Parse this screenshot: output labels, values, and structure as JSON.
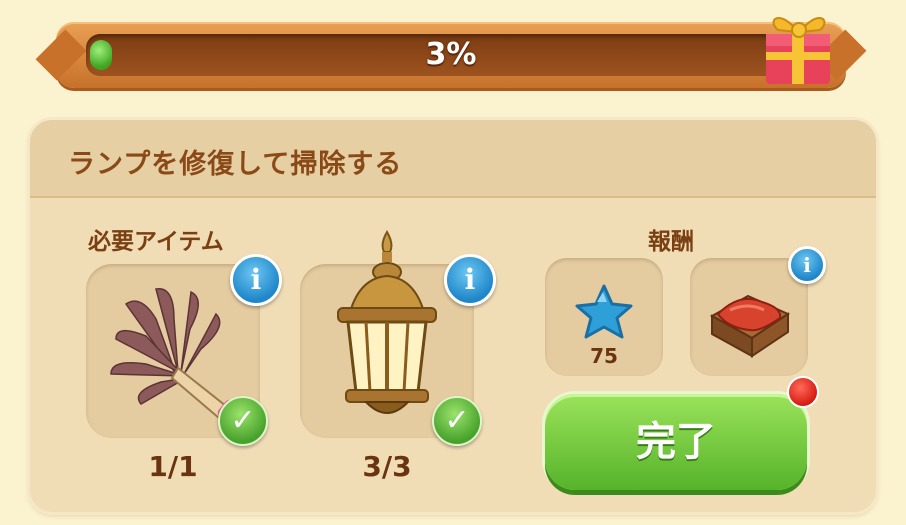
{
  "progress": {
    "percent_text": "3%",
    "value": 0.03
  },
  "quest": {
    "title": "ランプを修復して掃除する",
    "required_label": "必要アイテム",
    "reward_label": "報酬",
    "items": [
      {
        "name": "feather-duster",
        "count": "1/1",
        "complete": true
      },
      {
        "name": "lantern",
        "count": "3/3",
        "complete": true
      }
    ],
    "rewards": [
      {
        "name": "blue-star",
        "count": "75"
      },
      {
        "name": "wooden-crate",
        "count": ""
      }
    ],
    "done_label": "完了"
  },
  "icons": {
    "info": "i",
    "check": "✓"
  },
  "colors": {
    "background": "#fbf3cf",
    "progress_frame": "#c7712b",
    "progress_fill": "#3ea522",
    "panel": "#f0ddb6",
    "title_text": "#8a4a18",
    "info_badge": "#1f86c9",
    "check_badge": "#47a22b",
    "done_button": "#56b32a",
    "notification": "#d61c12"
  }
}
